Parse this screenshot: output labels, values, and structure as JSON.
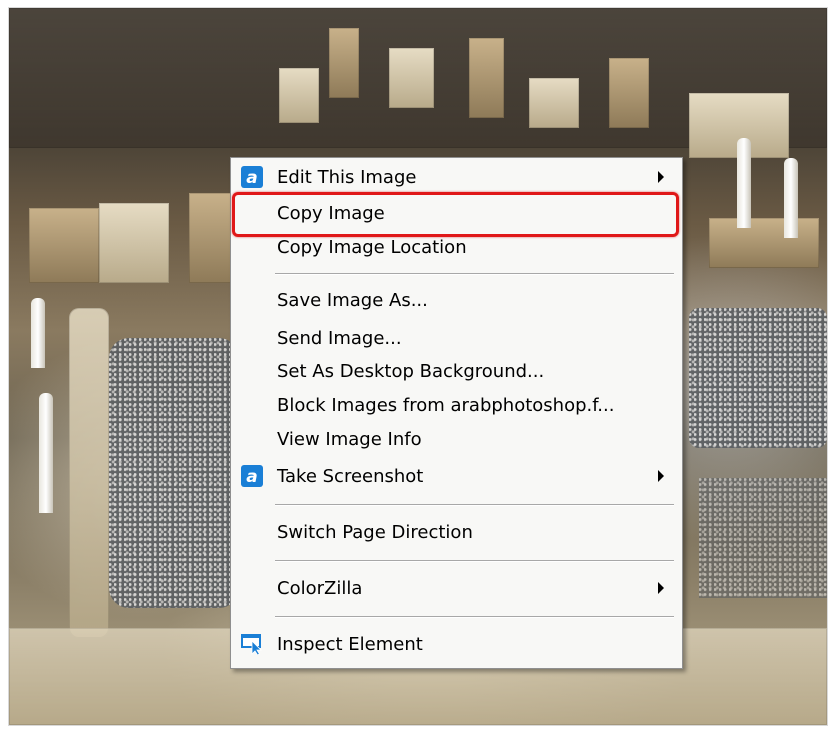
{
  "context_menu": {
    "items": [
      {
        "label": "Edit This Image",
        "icon": "aviary-icon",
        "has_submenu": true
      },
      {
        "label": "Copy Image",
        "highlighted": true
      },
      {
        "label": "Copy Image Location"
      },
      {
        "label": "Save Image As..."
      },
      {
        "label": "Send Image..."
      },
      {
        "label": "Set As Desktop Background..."
      },
      {
        "label": "Block Images from arabphotoshop.f..."
      },
      {
        "label": "View Image Info"
      },
      {
        "label": "Take Screenshot",
        "icon": "aviary-icon",
        "has_submenu": true
      },
      {
        "label": "Switch Page Direction"
      },
      {
        "label": "ColorZilla",
        "has_submenu": true
      },
      {
        "label": "Inspect Element",
        "icon": "inspect-icon"
      }
    ]
  },
  "colors": {
    "highlight_border": "#e01818",
    "menu_background": "#f8f8f6",
    "icon_blue": "#1a7fd6"
  }
}
